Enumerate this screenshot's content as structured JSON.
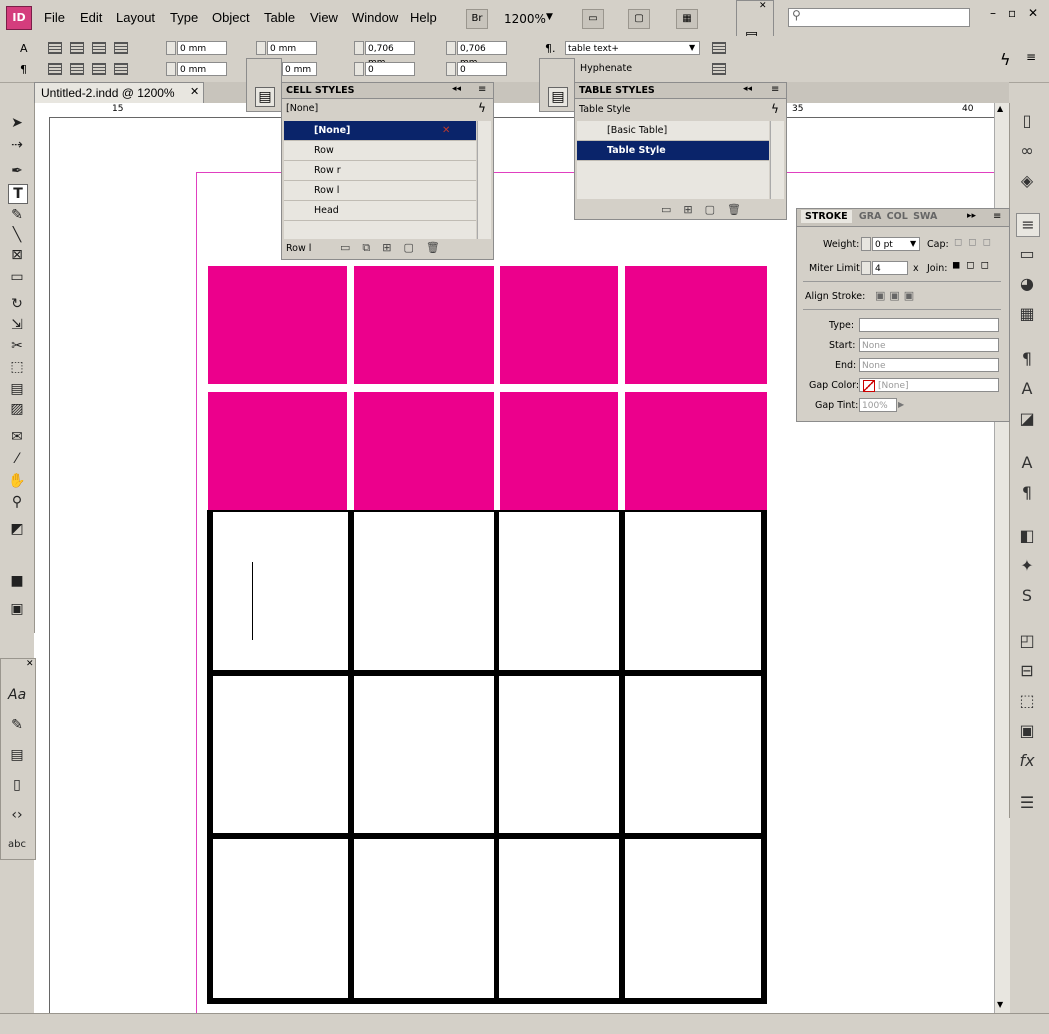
{
  "app": {
    "logo": "ID"
  },
  "menu": [
    "File",
    "Edit",
    "Layout",
    "Type",
    "Object",
    "Table",
    "View",
    "Window",
    "Help"
  ],
  "toolbar": {
    "bridge": "Br",
    "zoom": "1200%"
  },
  "control": {
    "indent_left": "0 mm",
    "indent_first": "0 mm",
    "space_before": "0 mm",
    "indent_right": "0 mm",
    "space_after": "0 mm",
    "leading_top": "0,706 mm",
    "leading_bottom": "0,706 mm",
    "baseline_a": "0",
    "baseline_b": "0",
    "para_style": "table text+",
    "hyphenate": "Hyphenate"
  },
  "document": {
    "tab_title": "Untitled-2.indd @ 1200%"
  },
  "ruler": {
    "h_15": "15",
    "h_35": "35",
    "h_40": "40"
  },
  "cell_styles": {
    "title": "CELL STYLES",
    "current": "[None]",
    "items": [
      "[None]",
      "Row",
      "Row r",
      "Row l",
      "Head"
    ],
    "selected": "[None]",
    "footer": "Row l"
  },
  "table_styles": {
    "title": "TABLE STYLES",
    "current": "Table Style",
    "items": [
      "[Basic Table]",
      "Table Style"
    ],
    "selected": "Table Style"
  },
  "stroke": {
    "tabs": [
      "STROKE",
      "GRA",
      "COL",
      "SWA"
    ],
    "weight_label": "Weight:",
    "weight": "0 pt",
    "cap_label": "Cap:",
    "miter_label": "Miter Limit:",
    "miter": "4",
    "miter_x": "x",
    "join_label": "Join:",
    "align_label": "Align Stroke:",
    "type_label": "Type:",
    "type": "",
    "start_label": "Start:",
    "start": "None",
    "end_label": "End:",
    "end": "None",
    "gap_color_label": "Gap Color:",
    "gap_color": "[None]",
    "gap_tint_label": "Gap Tint:",
    "gap_tint": "100%"
  },
  "colors": {
    "magenta": "#ec008c",
    "selection": "#0a246a"
  }
}
